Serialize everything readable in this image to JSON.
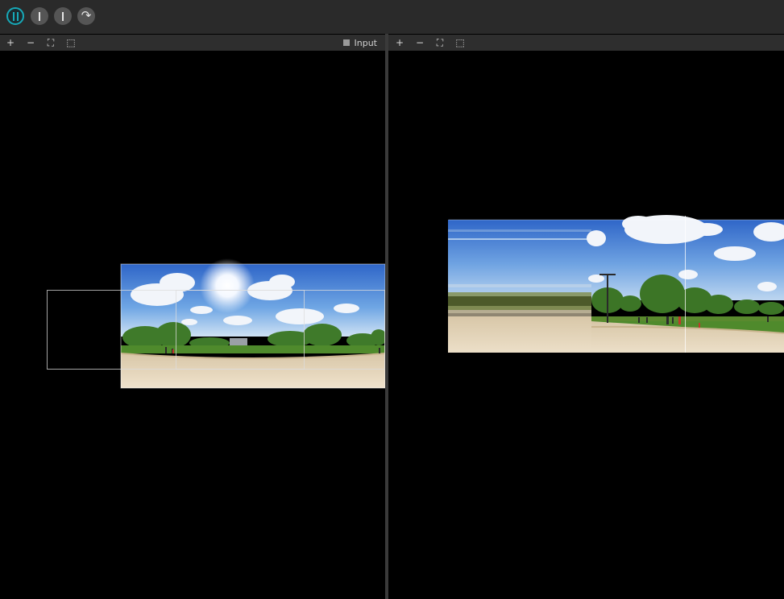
{
  "toolbar": {
    "buttons": [
      {
        "name": "pause-button",
        "icon": "pause-icon",
        "active": true
      },
      {
        "name": "step-button",
        "icon": "bar-icon"
      },
      {
        "name": "step-back-button",
        "icon": "bar-icon"
      },
      {
        "name": "redo-button",
        "icon": "redo-icon"
      }
    ],
    "redo_glyph": "↷"
  },
  "left_panel": {
    "zoom_in": "+",
    "zoom_out": "−",
    "fit": "⛶",
    "select": "⬚",
    "input_label": "Input"
  },
  "right_panel": {
    "zoom_in": "+",
    "zoom_out": "−",
    "fit": "⛶",
    "select": "⬚"
  },
  "colors": {
    "accent": "#17a9b8",
    "sky_top": "#2f66c8",
    "sky_low": "#8fbde8",
    "grass": "#4f8a2c",
    "ground": "#e3d2b6"
  }
}
